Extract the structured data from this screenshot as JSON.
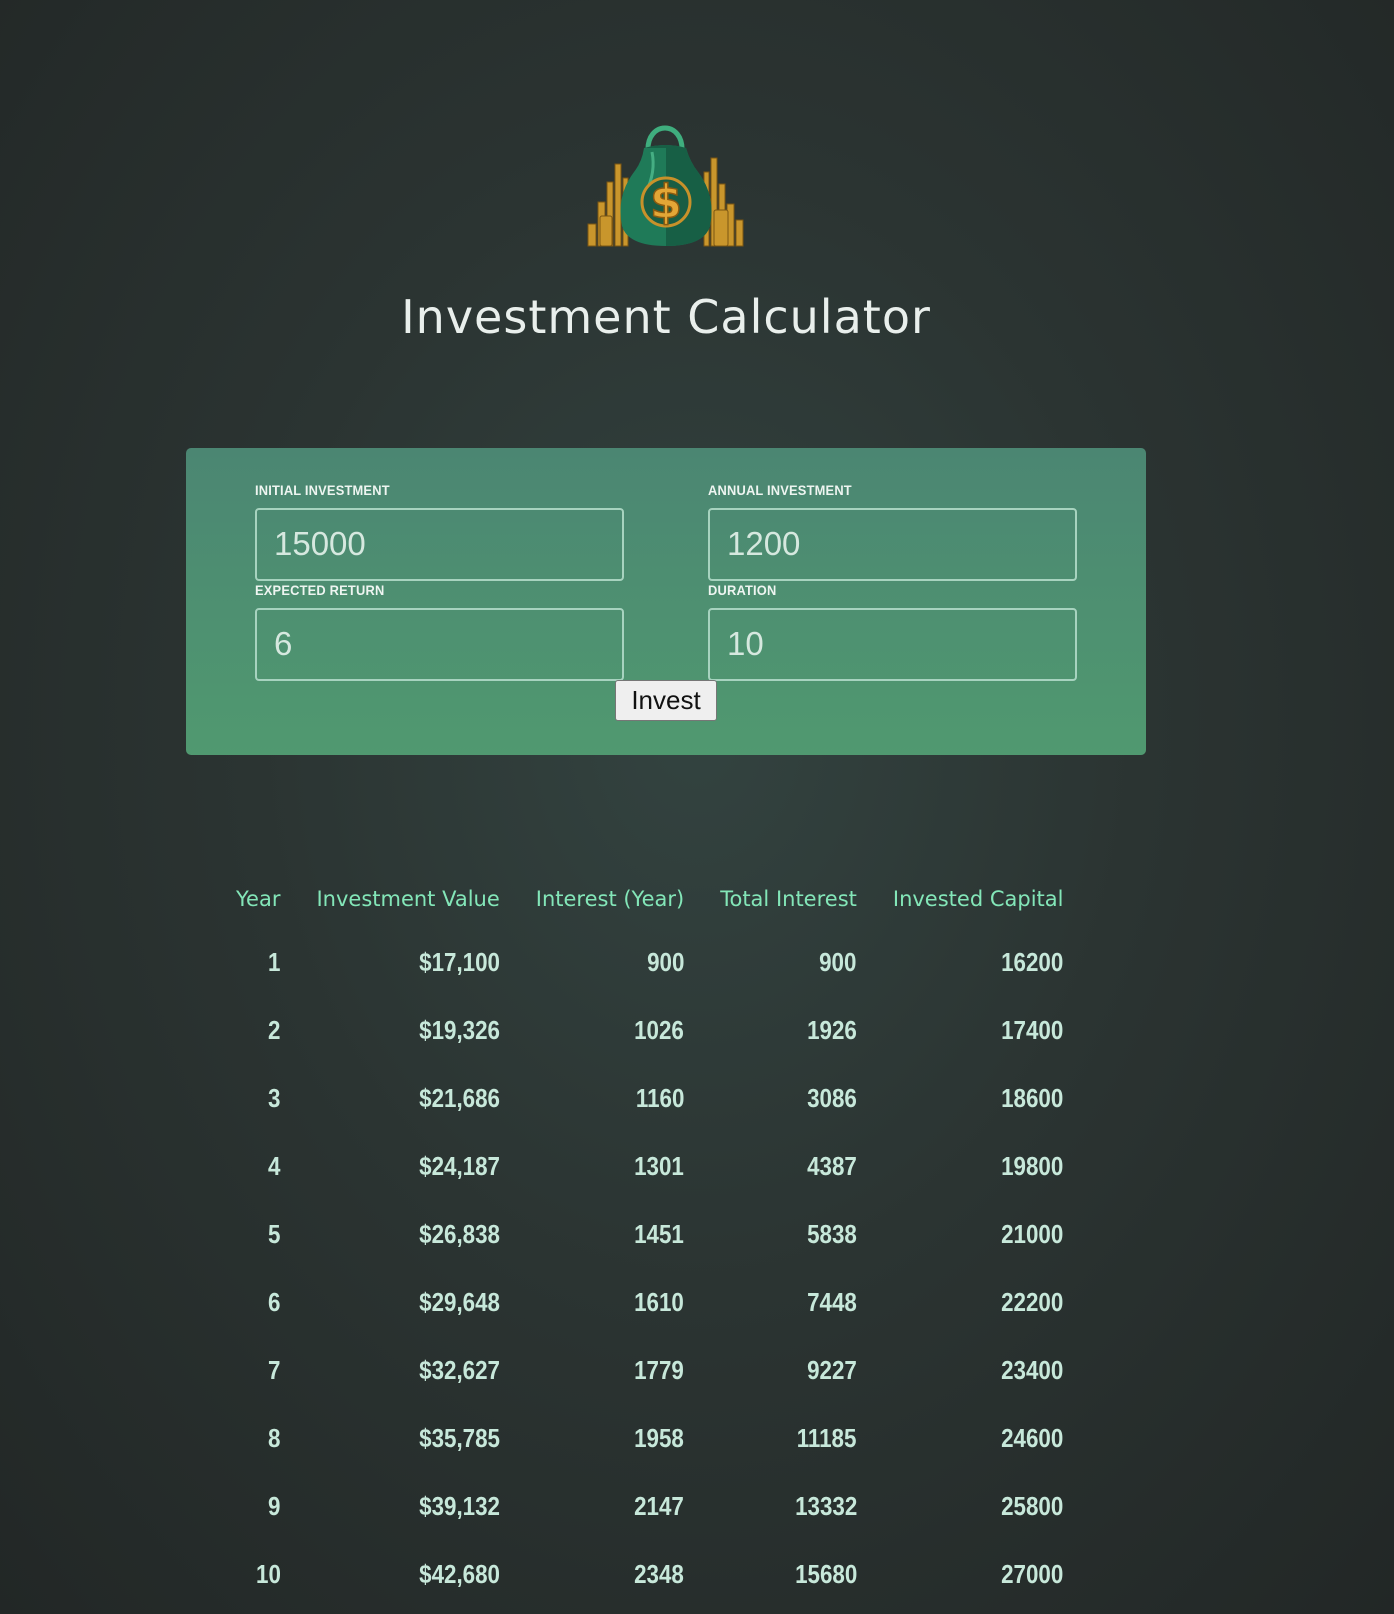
{
  "header": {
    "title": "Investment Calculator"
  },
  "form": {
    "initial_investment": {
      "label": "INITIAL INVESTMENT",
      "value": "15000"
    },
    "annual_investment": {
      "label": "ANNUAL INVESTMENT",
      "value": "1200"
    },
    "expected_return": {
      "label": "EXPECTED RETURN",
      "value": "6"
    },
    "duration": {
      "label": "DURATION",
      "value": "10"
    },
    "invest_label": "Invest"
  },
  "results": {
    "headers": [
      "Year",
      "Investment Value",
      "Interest (Year)",
      "Total Interest",
      "Invested Capital"
    ],
    "rows": [
      [
        "1",
        "$17,100",
        "900",
        "900",
        "16200"
      ],
      [
        "2",
        "$19,326",
        "1026",
        "1926",
        "17400"
      ],
      [
        "3",
        "$21,686",
        "1160",
        "3086",
        "18600"
      ],
      [
        "4",
        "$24,187",
        "1301",
        "4387",
        "19800"
      ],
      [
        "5",
        "$26,838",
        "1451",
        "5838",
        "21000"
      ],
      [
        "6",
        "$29,648",
        "1610",
        "7448",
        "22200"
      ],
      [
        "7",
        "$32,627",
        "1779",
        "9227",
        "23400"
      ],
      [
        "8",
        "$35,785",
        "1958",
        "11185",
        "24600"
      ],
      [
        "9",
        "$39,132",
        "2147",
        "13332",
        "25800"
      ],
      [
        "10",
        "$42,680",
        "2348",
        "15680",
        "27000"
      ]
    ]
  },
  "icons": {
    "logo": "money-bag-icon"
  },
  "colors": {
    "background": "#2b3432",
    "panel_top": "#4b8672",
    "panel_bottom": "#509970",
    "header_text": "#83e6b8",
    "cell_text": "#c7e8da"
  }
}
